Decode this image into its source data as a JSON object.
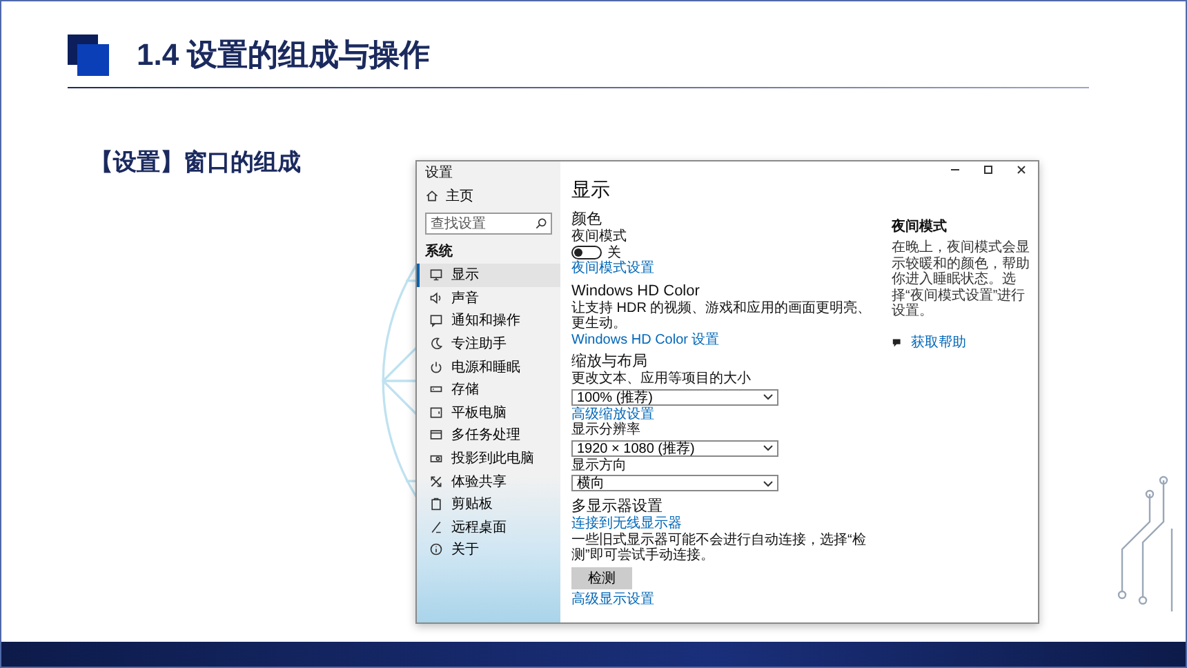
{
  "slide": {
    "title": "1.4 设置的组成与操作",
    "subtitle": "【设置】窗口的组成"
  },
  "settings_window": {
    "title": "设置",
    "sidebar": {
      "home": "主页",
      "search": {
        "placeholder": "查找设置"
      },
      "section": "系统",
      "items": [
        {
          "label": "显示",
          "selected": true
        },
        {
          "label": "声音",
          "selected": false
        },
        {
          "label": "通知和操作",
          "selected": false
        },
        {
          "label": "专注助手",
          "selected": false
        },
        {
          "label": "电源和睡眠",
          "selected": false
        },
        {
          "label": "存储",
          "selected": false
        },
        {
          "label": "平板电脑",
          "selected": false
        },
        {
          "label": "多任务处理",
          "selected": false
        },
        {
          "label": "投影到此电脑",
          "selected": false
        },
        {
          "label": "体验共享",
          "selected": false
        },
        {
          "label": "剪贴板",
          "selected": false
        },
        {
          "label": "远程桌面",
          "selected": false
        },
        {
          "label": "关于",
          "selected": false
        }
      ]
    },
    "content": {
      "title": "显示",
      "blocks": [
        {
          "kind": "heading",
          "text": "颜色"
        },
        {
          "kind": "label",
          "text": "夜间模式"
        },
        {
          "kind": "toggle",
          "on": false,
          "text": "关"
        },
        {
          "kind": "link",
          "text": "夜间模式设置"
        },
        {
          "kind": "heading",
          "text": "Windows HD Color"
        },
        {
          "kind": "text",
          "text": "让支持 HDR 的视频、游戏和应用的画面更明亮、更生动。"
        },
        {
          "kind": "link",
          "text": "Windows HD Color 设置"
        },
        {
          "kind": "heading",
          "text": "缩放与布局"
        },
        {
          "kind": "label",
          "text": "更改文本、应用等项目的大小"
        },
        {
          "kind": "dropdown",
          "text": "100% (推荐)"
        },
        {
          "kind": "link",
          "text": "高级缩放设置"
        },
        {
          "kind": "label",
          "text": "显示分辨率"
        },
        {
          "kind": "dropdown",
          "text": "1920 × 1080 (推荐)"
        },
        {
          "kind": "label",
          "text": "显示方向"
        },
        {
          "kind": "dropdown",
          "text": "横向"
        },
        {
          "kind": "heading",
          "text": "多显示器设置"
        },
        {
          "kind": "link",
          "text": "连接到无线显示器"
        },
        {
          "kind": "text",
          "text": "一些旧式显示器可能不会进行自动连接，选择“检测”即可尝试手动连接。"
        },
        {
          "kind": "button",
          "text": "检测"
        },
        {
          "kind": "link",
          "text": "高级显示设置"
        }
      ]
    },
    "aside": {
      "title": "夜间模式",
      "text": "在晚上，夜间模式会显示较暖和的颜色，帮助你进入睡眠状态。选择“夜间模式设置”进行设置。",
      "help_link": "获取帮助"
    }
  }
}
